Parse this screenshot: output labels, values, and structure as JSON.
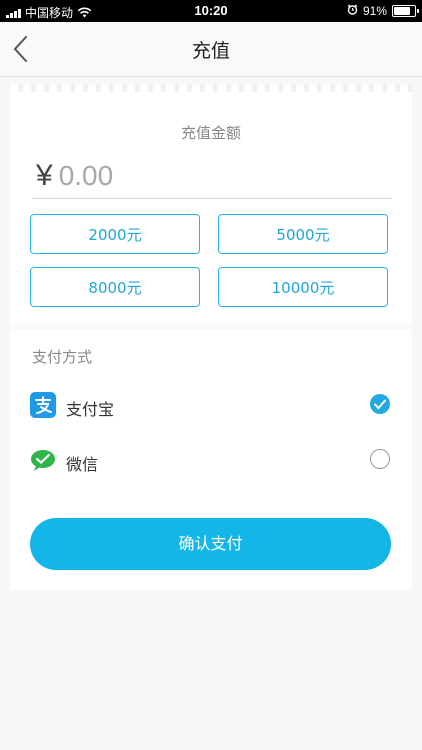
{
  "status_bar": {
    "carrier": "中国移动",
    "time": "10:20",
    "battery": "91%",
    "battery_level": 0.91
  },
  "nav": {
    "title": "充值",
    "back_icon": "chevron-left-icon"
  },
  "recharge": {
    "amount_label": "充值金额",
    "currency_symbol": "¥",
    "amount_placeholder": "0.00",
    "presets": [
      {
        "label": "2000元"
      },
      {
        "label": "5000元"
      },
      {
        "label": "8000元"
      },
      {
        "label": "10000元"
      }
    ]
  },
  "payment": {
    "label": "支付方式",
    "methods": [
      {
        "name": "支付宝",
        "icon": "alipay-icon",
        "selected": true,
        "color": "#1e9be8"
      },
      {
        "name": "微信",
        "icon": "wechat-icon",
        "selected": false,
        "color": "#2fb44a"
      }
    ]
  },
  "confirm_label": "确认支付",
  "colors": {
    "accent": "#14b6e7",
    "preset_border": "#29b6e6"
  }
}
